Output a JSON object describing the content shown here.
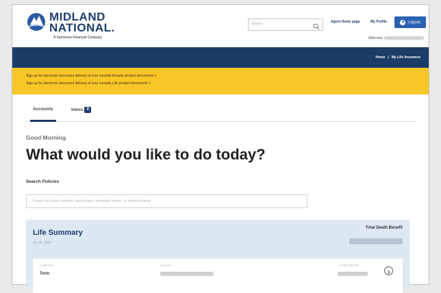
{
  "brand": {
    "line1": "MIDLAND",
    "line2": "NATIONAL.",
    "sub": "A Sammons Financial Company"
  },
  "header": {
    "search_placeholder": "Search",
    "agent_link": "Agent Home page",
    "profile_link": "My Profile",
    "logout_label": "Logout",
    "welcome_label": "Welcome"
  },
  "breadcrumb": {
    "home": "Home",
    "separator": "|",
    "current": "My Life Insurance"
  },
  "banner": {
    "line1": "Sign up for electronic document delivery of your variable Annuity product documents >",
    "line2": "Sign up for electronic document delivery of your variable Life product documents >"
  },
  "tabs": {
    "accounts": "Accounts",
    "inbox": "Inbox",
    "inbox_count": "0"
  },
  "main": {
    "greeting": "Good Morning",
    "headline": "What would you like to do today?",
    "search_label": "Search Policies",
    "search_placeholder": "Search by policy number, policy type, annuitant name, or insured name"
  },
  "summary": {
    "title": "Life Summary",
    "date": "Jul 24, 2020",
    "total_label": "Total Death Benefit",
    "col_left": "Collection",
    "col_mid": "Insured",
    "col_right": "Death Benefit",
    "row_type": "Term"
  },
  "colors": {
    "brand_navy": "#1b3c67",
    "banner_yellow": "#f8c626",
    "logout_blue": "#2b62b2",
    "summary_bg": "#dde8f3"
  }
}
